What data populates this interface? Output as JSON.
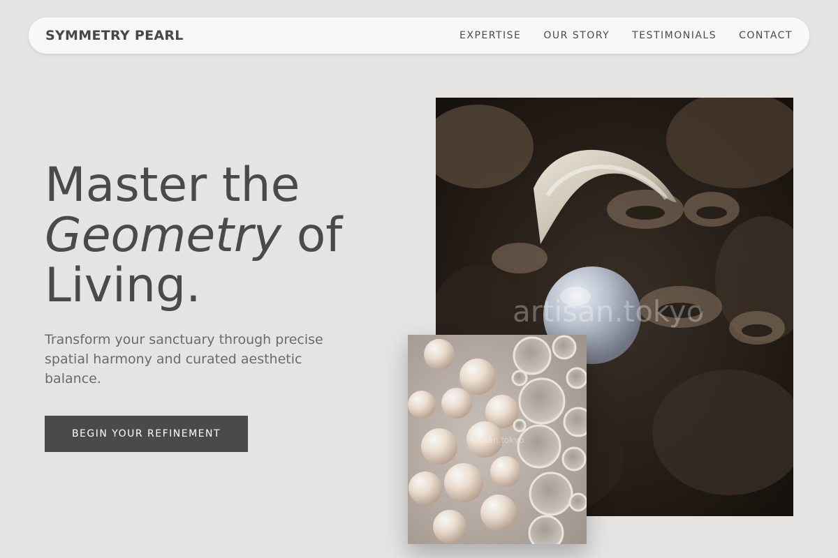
{
  "nav": {
    "brand": "SYMMETRY PEARL",
    "links": [
      "EXPERTISE",
      "OUR STORY",
      "TESTIMONIALS",
      "CONTACT"
    ]
  },
  "hero": {
    "title_line1": "Master the",
    "title_em": "Geometry",
    "title_of": " of",
    "title_line3": "Living.",
    "subtitle": "Transform your sanctuary through precise spatial harmony and curated aesthetic balance.",
    "cta_label": "BEGIN YOUR REFINEMENT"
  },
  "images": {
    "main_alt": "Pearl in oyster shell",
    "main_watermark": "artisan.tokyo",
    "small_alt": "Pearls and bubbles",
    "small_watermark": "artisan.tokyo"
  },
  "colors": {
    "background": "#e6e4e2",
    "nav_bg": "#f8f8f8",
    "text": "#4a4a4a",
    "cta_bg": "#4a4a4a"
  }
}
